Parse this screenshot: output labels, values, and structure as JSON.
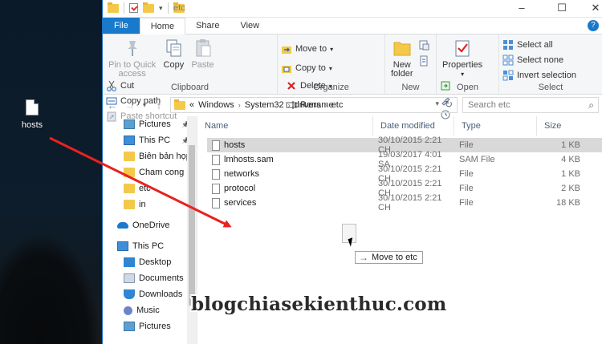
{
  "desktop": {
    "icon_label": "hosts"
  },
  "window": {
    "title": "etc",
    "controls": [
      "–",
      "☐",
      "✕"
    ]
  },
  "tabs": {
    "file": "File",
    "home": "Home",
    "share": "Share",
    "view": "View"
  },
  "ribbon": {
    "clipboard": {
      "label": "Clipboard",
      "pin_line1": "Pin to Quick",
      "pin_line2": "access",
      "copy": "Copy",
      "paste": "Paste",
      "cut": "Cut",
      "copy_path": "Copy path",
      "paste_shortcut": "Paste shortcut"
    },
    "organize": {
      "label": "Organize",
      "move_to": "Move to",
      "copy_to": "Copy to",
      "delete": "Delete",
      "rename": "Rename"
    },
    "new": {
      "label": "New",
      "new_folder_line1": "New",
      "new_folder_line2": "folder"
    },
    "open": {
      "label": "Open",
      "properties": "Properties"
    },
    "select": {
      "label": "Select",
      "select_all": "Select all",
      "select_none": "Select none",
      "invert_selection": "Invert selection"
    }
  },
  "address": {
    "overflow": "«",
    "crumbs": [
      "Windows",
      "System32",
      "drivers",
      "etc"
    ],
    "search_placeholder": "Search etc"
  },
  "navpane": {
    "items": [
      {
        "label": "Pictures",
        "icon": "pictures-icon",
        "pinned": true
      },
      {
        "label": "This PC",
        "icon": "pc-icon",
        "pinned": true
      },
      {
        "label": "Biên bản họp tổ",
        "icon": "folder-icon",
        "pinned": false
      },
      {
        "label": "Cham cong",
        "icon": "folder-icon",
        "pinned": false
      },
      {
        "label": "etc",
        "icon": "folder-icon",
        "pinned": false
      },
      {
        "label": "in",
        "icon": "folder-icon",
        "pinned": false
      },
      {
        "label": "OneDrive",
        "icon": "onedrive-icon",
        "pinned": false
      },
      {
        "label": "This PC",
        "icon": "pc-icon",
        "pinned": false
      },
      {
        "label": "Desktop",
        "icon": "desktop-icon",
        "pinned": false
      },
      {
        "label": "Documents",
        "icon": "documents-icon",
        "pinned": false
      },
      {
        "label": "Downloads",
        "icon": "downloads-icon",
        "pinned": false
      },
      {
        "label": "Music",
        "icon": "music-icon",
        "pinned": false
      },
      {
        "label": "Pictures",
        "icon": "pictures-icon",
        "pinned": false
      }
    ]
  },
  "columns": {
    "name": "Name",
    "date": "Date modified",
    "type": "Type",
    "size": "Size"
  },
  "files": [
    {
      "name": "hosts",
      "date": "30/10/2015 2:21 CH",
      "type": "File",
      "size": "1 KB"
    },
    {
      "name": "lmhosts.sam",
      "date": "19/03/2017 4:01 SA",
      "type": "SAM File",
      "size": "4 KB"
    },
    {
      "name": "networks",
      "date": "30/10/2015 2:21 CH",
      "type": "File",
      "size": "1 KB"
    },
    {
      "name": "protocol",
      "date": "30/10/2015 2:21 CH",
      "type": "File",
      "size": "2 KB"
    },
    {
      "name": "services",
      "date": "30/10/2015 2:21 CH",
      "type": "File",
      "size": "18 KB"
    }
  ],
  "drag": {
    "tooltip": "Move to etc"
  },
  "watermark": "blogchiasekienthuc.com",
  "colors": {
    "accent": "#1979ca",
    "arrow": "#e8221f",
    "selection": "#d9d9d9",
    "folder": "#f4c94a"
  }
}
